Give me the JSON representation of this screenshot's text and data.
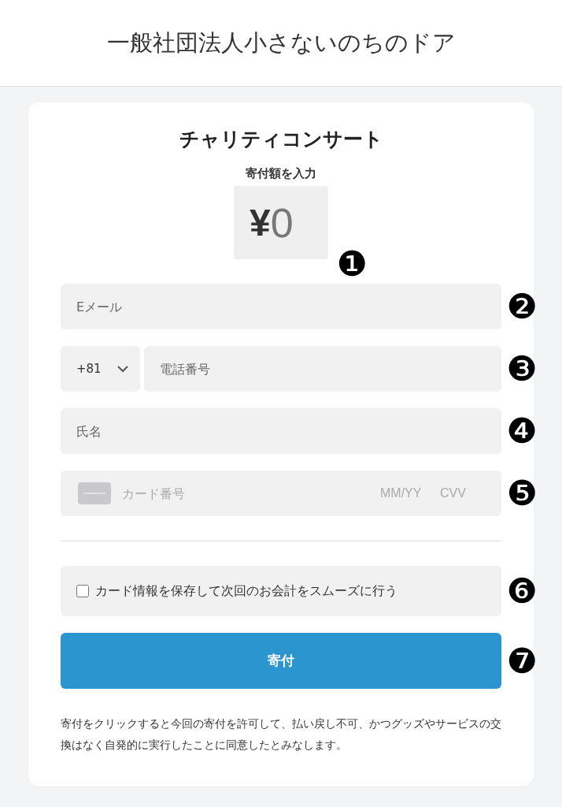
{
  "header": {
    "title": "一般社団法人小さないのちのドア"
  },
  "form": {
    "title": "チャリティコンサート",
    "amount": {
      "label": "寄付額を入力",
      "currency": "¥",
      "placeholder": "0",
      "marker": "❶"
    },
    "email": {
      "placeholder": "Eメール",
      "marker": "❷"
    },
    "phone": {
      "country_code": "+81",
      "placeholder": "電話番号",
      "marker": "❸"
    },
    "name": {
      "placeholder": "氏名",
      "marker": "❹"
    },
    "card": {
      "placeholder": "カード番号",
      "expiry_placeholder": "MM/YY",
      "cvv_placeholder": "CVV",
      "marker": "❺"
    },
    "save_card": {
      "label": "カード情報を保存して次回のお会計をスムーズに行う",
      "checked": false,
      "marker": "❻"
    },
    "submit": {
      "label": "寄付",
      "marker": "❼"
    },
    "notice": "寄付をクリックすると今回の寄付を許可して、払い戻し不可、かつグッズやサービスの交換はなく自発的に実行したことに同意したとみなします。"
  }
}
